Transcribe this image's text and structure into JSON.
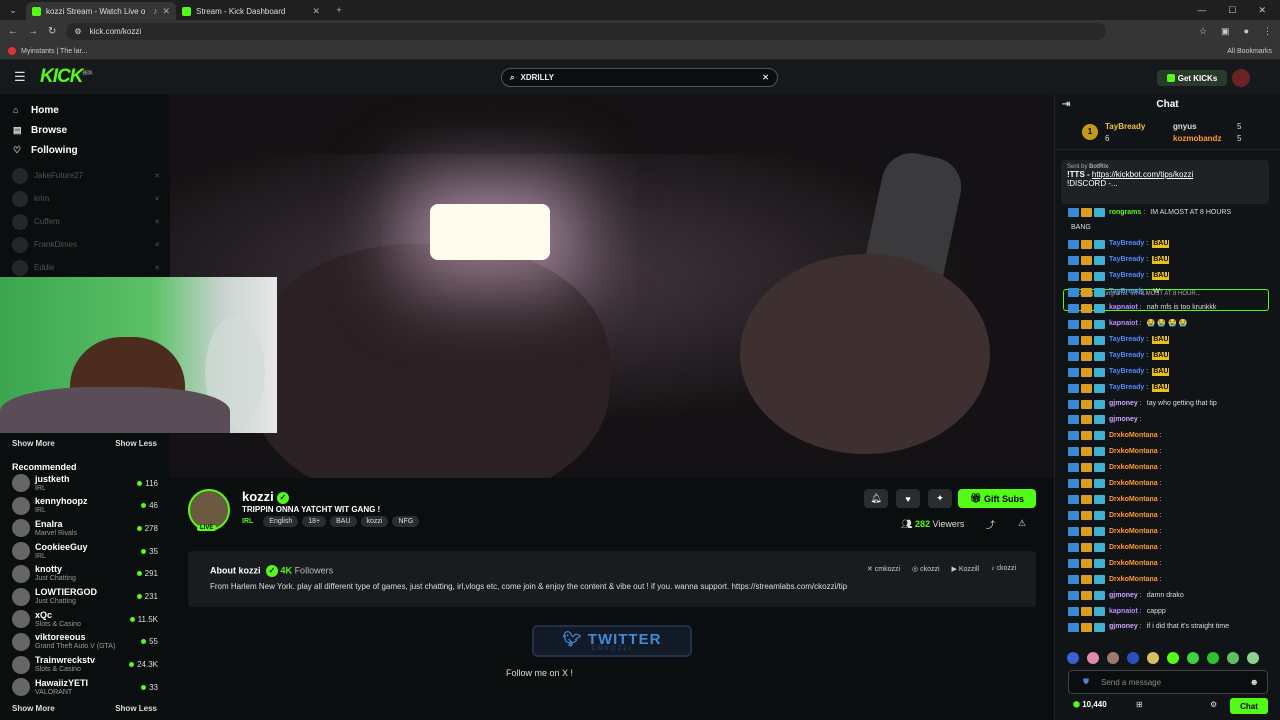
{
  "browser": {
    "tabs": [
      {
        "title": "kozzi Stream - Watch Live o",
        "active": true
      },
      {
        "title": "Stream - Kick Dashboard",
        "active": false
      }
    ],
    "url": "kick.com/kozzi",
    "bookmark": "Myinstants | The lar...",
    "all_bookmarks": "All Bookmarks"
  },
  "header": {
    "logo": "KICK",
    "logo_beta": "BETA",
    "search_value": "XDRILLY",
    "get_kicks": "Get KICKs"
  },
  "sidebar": {
    "nav": [
      {
        "label": "Home",
        "icon": "home-icon"
      },
      {
        "label": "Browse",
        "icon": "browse-icon"
      },
      {
        "label": "Following",
        "icon": "heart-icon"
      }
    ],
    "followed": [
      "JakeFuture27",
      "krim",
      "Cuffem",
      "FrankDimes",
      "Eddie"
    ],
    "show_more": "Show More",
    "show_less": "Show Less",
    "recommended_title": "Recommended",
    "recommended": [
      {
        "name": "justketh",
        "category": "IRL",
        "viewers": "116"
      },
      {
        "name": "kennyhoopz",
        "category": "IRL",
        "viewers": "46"
      },
      {
        "name": "Enalra",
        "category": "Marvel Rivals",
        "viewers": "278"
      },
      {
        "name": "CookieeGuy",
        "category": "IRL",
        "viewers": "35"
      },
      {
        "name": "knotty",
        "category": "Just Chatting",
        "viewers": "291"
      },
      {
        "name": "LOWTIERGOD",
        "category": "Just Chatting",
        "viewers": "231"
      },
      {
        "name": "xQc",
        "category": "Slots & Casino",
        "viewers": "11.5K"
      },
      {
        "name": "viktoreeous",
        "category": "Grand Theft Auto V (GTA)",
        "viewers": "55"
      },
      {
        "name": "Trainwreckstv",
        "category": "Slots & Casino",
        "viewers": "24.3K"
      },
      {
        "name": "HawaiizYETI",
        "category": "VALORANT",
        "viewers": "33"
      }
    ]
  },
  "channel": {
    "name": "kozzi",
    "live_badge": "LIVE",
    "title": "TRIPPIN ONNA YATCHT WIT GANG !",
    "category": "IRL",
    "tags": [
      "English",
      "18+",
      "BAU",
      "kozzi",
      "NFG"
    ],
    "viewers": "282",
    "viewers_label": "Viewers",
    "gift_subs": "Gift Subs"
  },
  "about": {
    "title": "About kozzi",
    "followers": "4K",
    "followers_label": "Followers",
    "socials": [
      "cmkozzi",
      "ckozzi",
      "Kozzill",
      "ckozzi"
    ],
    "description": "From Harlem New York. play all different type of games, just chatting, irl,vlogs etc, come join & enjoy the content & vibe out ! if you. wanna support. https://streamlabs.com/ckozzi/tip",
    "twitter_banner": "TWITTER",
    "twitter_handle": "CMKOZZI",
    "follow_text": "Follow me on X !"
  },
  "chat": {
    "title": "Chat",
    "leaderboard": [
      {
        "rank": "1",
        "name": "TayBready",
        "count": "6"
      },
      {
        "name": "gnyus",
        "count": "5"
      },
      {
        "name": "kozmobandz",
        "count": "5"
      }
    ],
    "pinned_sent_by": "Sent by",
    "pinned_bot": "BotRix",
    "pinned_text_1": "!TTS - ",
    "pinned_link": "https://kickbot.com/tips/kozzi",
    "pinned_text_2": "!DISCORD -...",
    "reply_to": "Replying to rongrams: IM ALMOST AT 8 HOUR...",
    "messages": [
      {
        "user": "rongrams",
        "text": "IM ALMOST AT 8 HOURS",
        "color": "#53fc18"
      },
      {
        "user": "",
        "text": "BANG",
        "color": "#ddd"
      },
      {
        "user": "TayBready",
        "text": "BAU",
        "color": "#4b8cff",
        "emote": true
      },
      {
        "user": "TayBready",
        "text": "BAU",
        "color": "#4b8cff",
        "emote": true
      },
      {
        "user": "TayBready",
        "text": "BAU",
        "color": "#4b8cff",
        "emote": true
      },
      {
        "user": "TayBready",
        "text": "W",
        "color": "#4b8cff"
      },
      {
        "user": "kapnaiot",
        "text": "nah mfs is too krunkkk",
        "color": "#b58cff"
      },
      {
        "user": "kapnaiot",
        "text": "😭 😭 😭 😭",
        "color": "#b58cff"
      },
      {
        "user": "TayBready",
        "text": "BAU",
        "color": "#4b8cff",
        "emote": true
      },
      {
        "user": "TayBready",
        "text": "BAU",
        "color": "#4b8cff",
        "emote": true
      },
      {
        "user": "TayBready",
        "text": "BAU",
        "color": "#4b8cff",
        "emote": true
      },
      {
        "user": "TayBready",
        "text": "BAU",
        "color": "#4b8cff",
        "emote": true
      },
      {
        "user": "gjmoney",
        "text": "tay who getting that tip",
        "color": "#c9a6ff"
      },
      {
        "user": "gjmoney",
        "text": "",
        "color": "#c9a6ff"
      },
      {
        "user": "DrxkoMontana",
        "text": "",
        "color": "#ff9a2e"
      },
      {
        "user": "DrxkoMontana",
        "text": "",
        "color": "#ff9a2e"
      },
      {
        "user": "DrxkoMontana",
        "text": "",
        "color": "#ff9a2e"
      },
      {
        "user": "DrxkoMontana",
        "text": "",
        "color": "#ff9a2e"
      },
      {
        "user": "DrxkoMontana",
        "text": "",
        "color": "#ff9a2e"
      },
      {
        "user": "DrxkoMontana",
        "text": "",
        "color": "#ff9a2e"
      },
      {
        "user": "DrxkoMontana",
        "text": "",
        "color": "#ff9a2e"
      },
      {
        "user": "DrxkoMontana",
        "text": "",
        "color": "#ff9a2e"
      },
      {
        "user": "DrxkoMontana",
        "text": "",
        "color": "#ff9a2e"
      },
      {
        "user": "DrxkoMontana",
        "text": "",
        "color": "#ff9a2e"
      },
      {
        "user": "gjmoney",
        "text": "damn drako",
        "color": "#c9a6ff"
      },
      {
        "user": "kapnaiot",
        "text": "cappp",
        "color": "#b58cff"
      },
      {
        "user": "gjmoney",
        "text": "if i did that it's straight time",
        "color": "#c9a6ff"
      }
    ],
    "input_placeholder": "Send a message",
    "kicks_balance": "10,440",
    "chat_button": "Chat"
  },
  "colors": {
    "accent": "#53fc18",
    "background": "#0b0e0f"
  }
}
